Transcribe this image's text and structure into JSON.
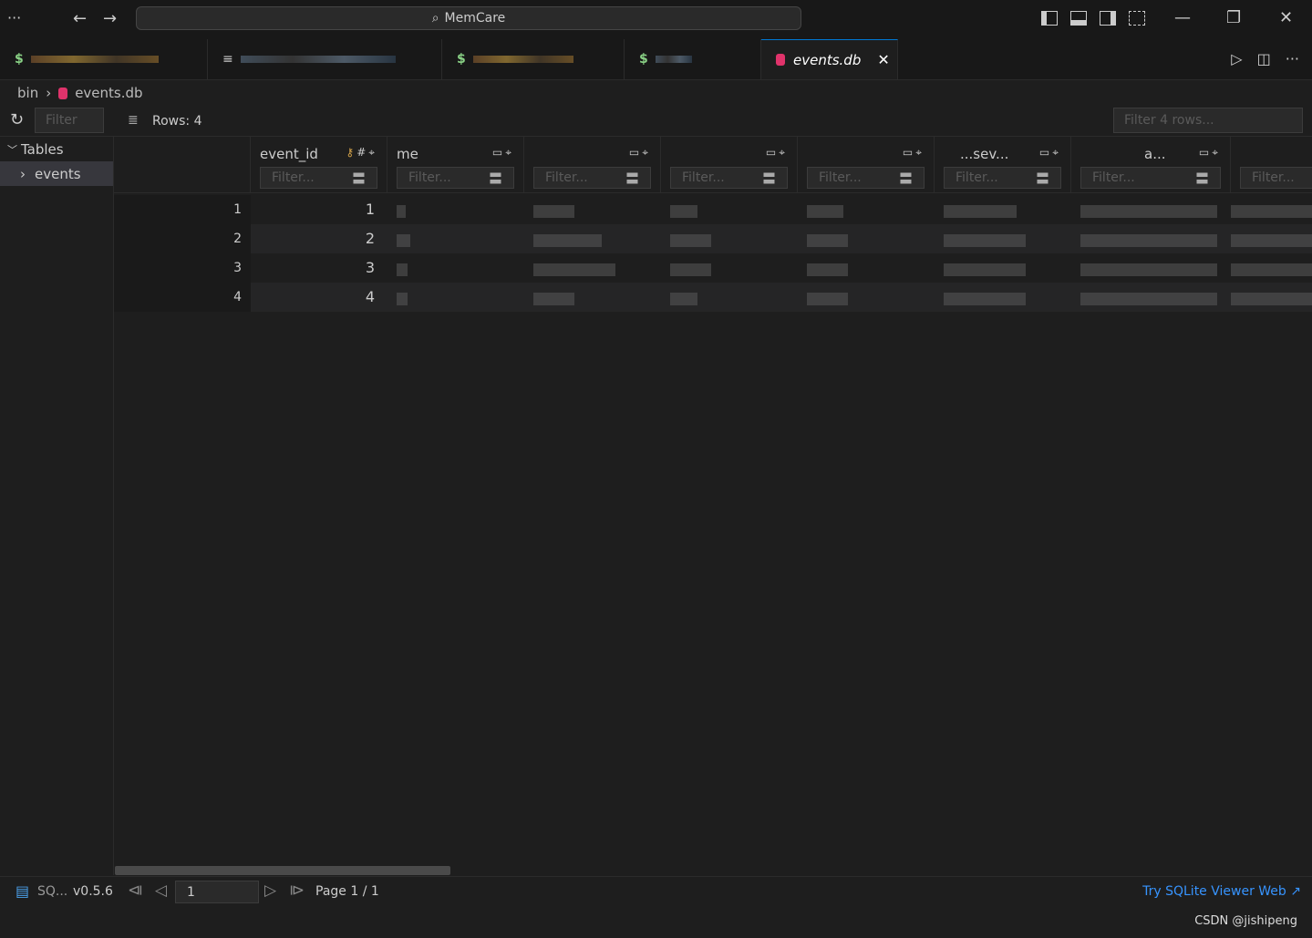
{
  "titlebar": {
    "menu_icon": "more-horizontal-icon",
    "search_label": "MemCare"
  },
  "tabs": [
    {
      "icon": "dollar-terminal-icon",
      "label": ""
    },
    {
      "icon": "list-icon",
      "label": ""
    },
    {
      "icon": "dollar-terminal-icon",
      "label": ""
    },
    {
      "icon": "dollar-terminal-icon",
      "label": ""
    },
    {
      "icon": "database-icon",
      "label": "events.db",
      "active": true
    }
  ],
  "breadcrumb": {
    "folder": "bin",
    "file": "events.db"
  },
  "toolbar": {
    "filter_placeholder": "Filter",
    "rows_label": "Rows: 4",
    "row_filter_placeholder": "Filter 4 rows..."
  },
  "sidebar": {
    "section": "Tables",
    "items": [
      "events"
    ]
  },
  "grid": {
    "columns": [
      {
        "name": "event_id",
        "filter": "Filter..."
      },
      {
        "name": "me",
        "filter": "Filter..."
      },
      {
        "name": "",
        "filter": "Filter..."
      },
      {
        "name": "",
        "filter": "Filter..."
      },
      {
        "name": "",
        "filter": "Filter..."
      },
      {
        "name": "...sev...",
        "filter": "Filter..."
      },
      {
        "name": "a...",
        "filter": "Filter..."
      },
      {
        "name": "",
        "filter": "Filter..."
      }
    ],
    "rows": [
      {
        "num": "1",
        "event_id": "1"
      },
      {
        "num": "2",
        "event_id": "2"
      },
      {
        "num": "3",
        "event_id": "3"
      },
      {
        "num": "4",
        "event_id": "4"
      }
    ]
  },
  "status": {
    "extension": "SQ...",
    "version": "v0.5.6",
    "page_value": "1",
    "page_label": "Page 1 / 1",
    "web_link": "Try SQLite Viewer Web ↗"
  },
  "watermark": "CSDN @jishipeng"
}
